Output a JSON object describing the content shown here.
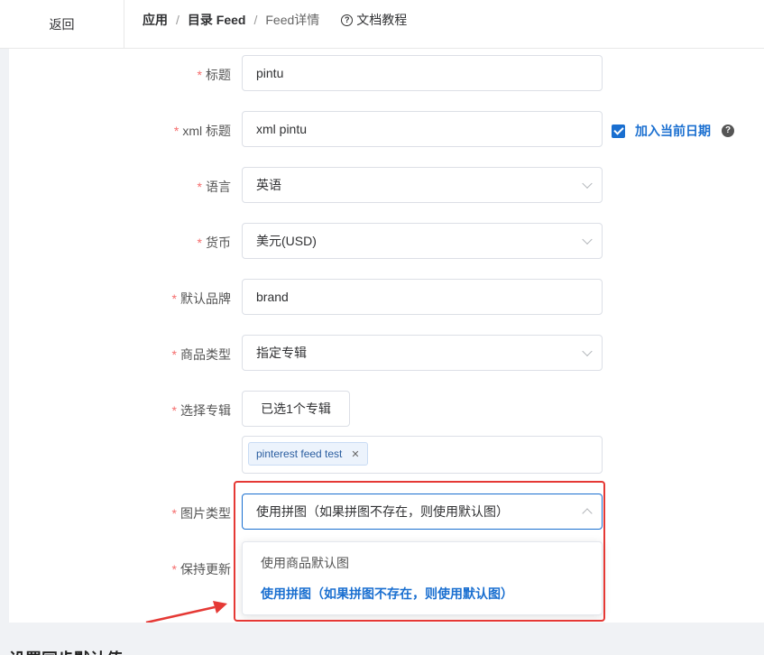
{
  "header": {
    "back_label": "返回",
    "breadcrumb": [
      "应用",
      "目录 Feed",
      "Feed详情"
    ],
    "separator": "/",
    "docs_label": "文档教程"
  },
  "form": {
    "title": {
      "label": "标题",
      "value": "pintu"
    },
    "xml_title": {
      "label": "xml 标题",
      "value": "xml pintu",
      "checkbox_label": "加入当前日期",
      "checked": true
    },
    "language": {
      "label": "语言",
      "value": "英语"
    },
    "currency": {
      "label": "货币",
      "value": "美元(USD)"
    },
    "brand": {
      "label": "默认品牌",
      "value": "brand"
    },
    "product_type": {
      "label": "商品类型",
      "value": "指定专辑"
    },
    "collection": {
      "label": "选择专辑",
      "button_label": "已选1个专辑",
      "tags": [
        "pinterest feed test"
      ]
    },
    "image_type": {
      "label": "图片类型",
      "value": "使用拼图（如果拼图不存在，则使用默认图）",
      "options": [
        "使用商品默认图",
        "使用拼图（如果拼图不存在，则使用默认图）"
      ],
      "selected_index": 1
    },
    "keep_updated": {
      "label": "保持更新"
    }
  },
  "section_title": "设置同步默认值",
  "colors": {
    "accent": "#1a6fd0",
    "required": "#f56c6c",
    "annotation": "#e53935"
  },
  "required_mark": "*"
}
